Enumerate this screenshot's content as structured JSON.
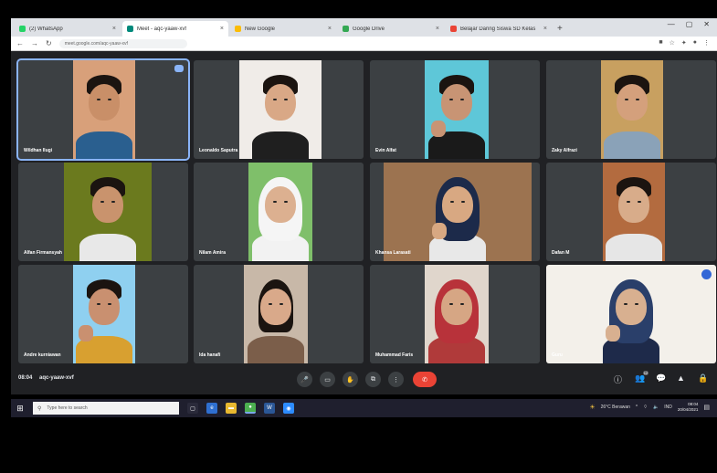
{
  "browser": {
    "tabs": [
      {
        "title": "(2) WhatsApp",
        "favicon_color": "#25d366",
        "active": false
      },
      {
        "title": "Meet - aqc-yaaw-xvf",
        "favicon_color": "#00897b",
        "active": true
      },
      {
        "title": "New Google",
        "favicon_color": "#fbbc04",
        "active": false
      },
      {
        "title": "Google Drive",
        "favicon_color": "#34a853",
        "active": false
      },
      {
        "title": "Belajar Daring Siswa SD Kelas",
        "favicon_color": "#ea4335",
        "active": false
      }
    ],
    "new_tab_glyph": "+",
    "url": "meet.google.com/aqc-yaaw-xvf",
    "nav_glyphs": {
      "back": "←",
      "forward": "→",
      "reload": "↻"
    }
  },
  "meeting": {
    "participants": [
      {
        "name": "Wildhan Ilugi",
        "bg": "#d8a07a",
        "skin": "#c98f68",
        "shirt": "#2a5f8f",
        "style": "boy"
      },
      {
        "name": "Leonaldo Saputra",
        "bg": "#f0ece8",
        "skin": "#d9a886",
        "shirt": "#1f1f1f",
        "style": "boy"
      },
      {
        "name": "Evin Alfat",
        "bg": "#5ec7d8",
        "skin": "#c89474",
        "shirt": "#1a1a1a",
        "style": "boy"
      },
      {
        "name": "Zaky Alfrazi",
        "bg": "#c8a060",
        "skin": "#d4a07c",
        "shirt": "#8aa2b8",
        "style": "boy"
      },
      {
        "name": "Alfan Firmansyah",
        "bg": "#6b7a1e",
        "skin": "#c9936d",
        "shirt": "#e8e8e8",
        "style": "boy"
      },
      {
        "name": "Nilam Amira",
        "bg": "#7fbf6a",
        "skin": "#dcb090",
        "shirt": "#f2f2f2",
        "style": "hijab",
        "hijab": "#f5f5f5"
      },
      {
        "name": "Khansa Larasati",
        "bg": "#9c7350",
        "skin": "#d8a882",
        "shirt": "#e8e8e8",
        "style": "hijab",
        "hijab": "#1c2a4a"
      },
      {
        "name": "Dafan M",
        "bg": "#b36b3f",
        "skin": "#d8ac8a",
        "shirt": "#e6e6e6",
        "style": "boy"
      },
      {
        "name": "Andre kurniawan",
        "bg": "#8fd0f0",
        "skin": "#c99070",
        "shirt": "#d8a030",
        "style": "boy"
      },
      {
        "name": "Ida hanafi",
        "bg": "#c8b8a8",
        "skin": "#d9a98a",
        "shirt": "#7b5e4a",
        "style": "girl"
      },
      {
        "name": "Muhammad Faris",
        "bg": "#e0d6cc",
        "skin": "#d6a684",
        "shirt": "#b03a3a",
        "style": "hijab",
        "hijab": "#b8323a"
      },
      {
        "name": "Guru",
        "bg": "#f3f0ea",
        "skin": "#d8b090",
        "shirt": "#1e2a4a",
        "style": "hijab",
        "hijab": "#2a3f6a"
      }
    ],
    "info": {
      "time": "08:04",
      "code": "aqc-yaaw-xvf"
    },
    "controls": [
      {
        "name": "mic",
        "glyph": "🎤"
      },
      {
        "name": "camera",
        "glyph": "▭"
      },
      {
        "name": "raise-hand",
        "glyph": "✋"
      },
      {
        "name": "present",
        "glyph": "⧉"
      },
      {
        "name": "more",
        "glyph": "⋮"
      }
    ],
    "end_call_glyph": "✆",
    "right_controls": [
      {
        "name": "info",
        "glyph": "ⓘ"
      },
      {
        "name": "people",
        "glyph": "👥",
        "badge": "12"
      },
      {
        "name": "chat",
        "glyph": "💬"
      },
      {
        "name": "activities",
        "glyph": "▲"
      },
      {
        "name": "lock",
        "glyph": "🔒"
      }
    ]
  },
  "taskbar": {
    "start_glyph": "⊞",
    "search_placeholder": "Type here to search",
    "search_glyph": "⚲",
    "apps": [
      {
        "name": "task-view",
        "glyph": "▢",
        "color": "#2a2a3a"
      },
      {
        "name": "edge",
        "glyph": "e",
        "color": "#2f6fd0"
      },
      {
        "name": "file-explorer",
        "glyph": "▬",
        "color": "#e8b830"
      },
      {
        "name": "chrome",
        "glyph": "●",
        "color": "#4caf50"
      },
      {
        "name": "word",
        "glyph": "W",
        "color": "#2b5797"
      },
      {
        "name": "zoom",
        "glyph": "◉",
        "color": "#2d8cff"
      }
    ],
    "tray_text": "26°C Berawan",
    "lang": "IND",
    "clock_time": "08:04",
    "clock_date": "20/04/2021"
  }
}
